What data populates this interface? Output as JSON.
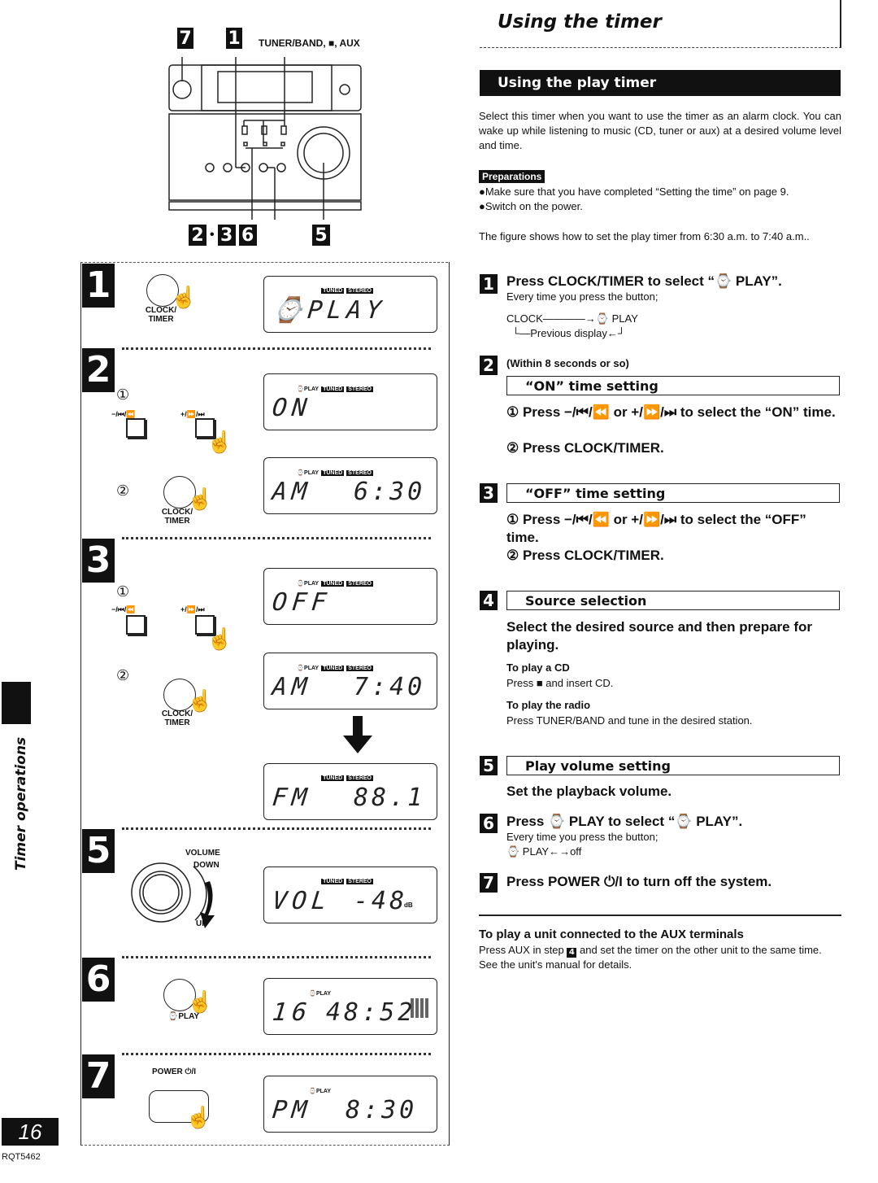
{
  "header": {
    "title": "Using the timer",
    "section": "Using the play timer"
  },
  "intro": "Select this timer when you want to use the timer as an alarm clock. You can wake up while listening to music (CD, tuner or aux) at a desired volume level and time.",
  "preparations": {
    "label": "Preparations",
    "items": [
      "●Make sure that you have completed “Setting the time” on page 9.",
      "●Switch on the power."
    ]
  },
  "figure_note": "The figure shows how to set the play timer from 6:30 a.m. to 7:40 a.m..",
  "steps": [
    {
      "num": "1",
      "title": "Press CLOCK/TIMER to select “⌚ PLAY”.",
      "sub": "Every time you press the button;",
      "cycle_line1": "CLOCK————→⌚ PLAY",
      "cycle_line2": "└—Previous display←┘"
    },
    {
      "num": "2",
      "note": "(Within 8 seconds or so)",
      "box": "“ON” time setting",
      "sub1": "① Press −/⏮/⏪ or +/⏩/⏭ to select the “ON” time.",
      "sub2": "② Press CLOCK/TIMER."
    },
    {
      "num": "3",
      "box": "“OFF” time setting",
      "sub1": "① Press −/⏮/⏪ or +/⏩/⏭ to select the “OFF” time.",
      "sub2": "② Press CLOCK/TIMER."
    },
    {
      "num": "4",
      "box": "Source selection",
      "title": "Select the desired source and then prepare for playing.",
      "cd_head": "To play a CD",
      "cd_text": "Press ■ and insert CD.",
      "radio_head": "To play the radio",
      "radio_text": "Press TUNER/BAND and tune in the desired station."
    },
    {
      "num": "5",
      "box": "Play volume setting",
      "title": "Set the playback volume."
    },
    {
      "num": "6",
      "title": "Press ⌚ PLAY to select “⌚ PLAY”.",
      "sub": "Every time you press the button;",
      "cycle": "⌚ PLAY←→off"
    },
    {
      "num": "7",
      "title": "Press POWER ⏻/I to turn off the system."
    }
  ],
  "aux": {
    "title": "To play a unit connected to the AUX terminals",
    "text_before": "Press AUX in step",
    "step_ref": "4",
    "text_after": "and set the timer on the other unit to the same time. See the unit's manual for details."
  },
  "device_figure": {
    "callout_top_left": "7",
    "callout_top": "1",
    "top_label": "TUNER/BAND, ■, AUX",
    "callouts_bottom": [
      "2",
      "•",
      "3",
      "6",
      "5"
    ]
  },
  "diagram": {
    "clock_timer_label": "CLOCK/ TIMER",
    "prev_label": "−/⏮/⏪",
    "next_label": "+/⏩/⏭",
    "circled_1": "①",
    "circled_2": "②",
    "volume_label": "VOLUME",
    "down_label": "DOWN",
    "up_label": "UP",
    "play_label": "⌚PLAY",
    "power_label": "POWER ⏻/I",
    "ind_tuned": "TUNED",
    "ind_stereo": "STEREO",
    "ind_play": "⌚PLAY",
    "displays": {
      "d1": "⌚PLAY",
      "d2": "ON",
      "d3a": "AM",
      "d3b": "6:30",
      "d4": "OFF",
      "d5a": "AM",
      "d5b": "7:40",
      "d6a": "FM",
      "d6b": "88.1",
      "d7a": "VOL",
      "d7b": "-48",
      "d7unit": "dB",
      "d8a": "16",
      "d8b": "48:52",
      "d9a": "PM",
      "d9b": "8:30"
    }
  },
  "side_tab": "Timer operations",
  "page_number": "16",
  "doc_code": "RQT5462"
}
